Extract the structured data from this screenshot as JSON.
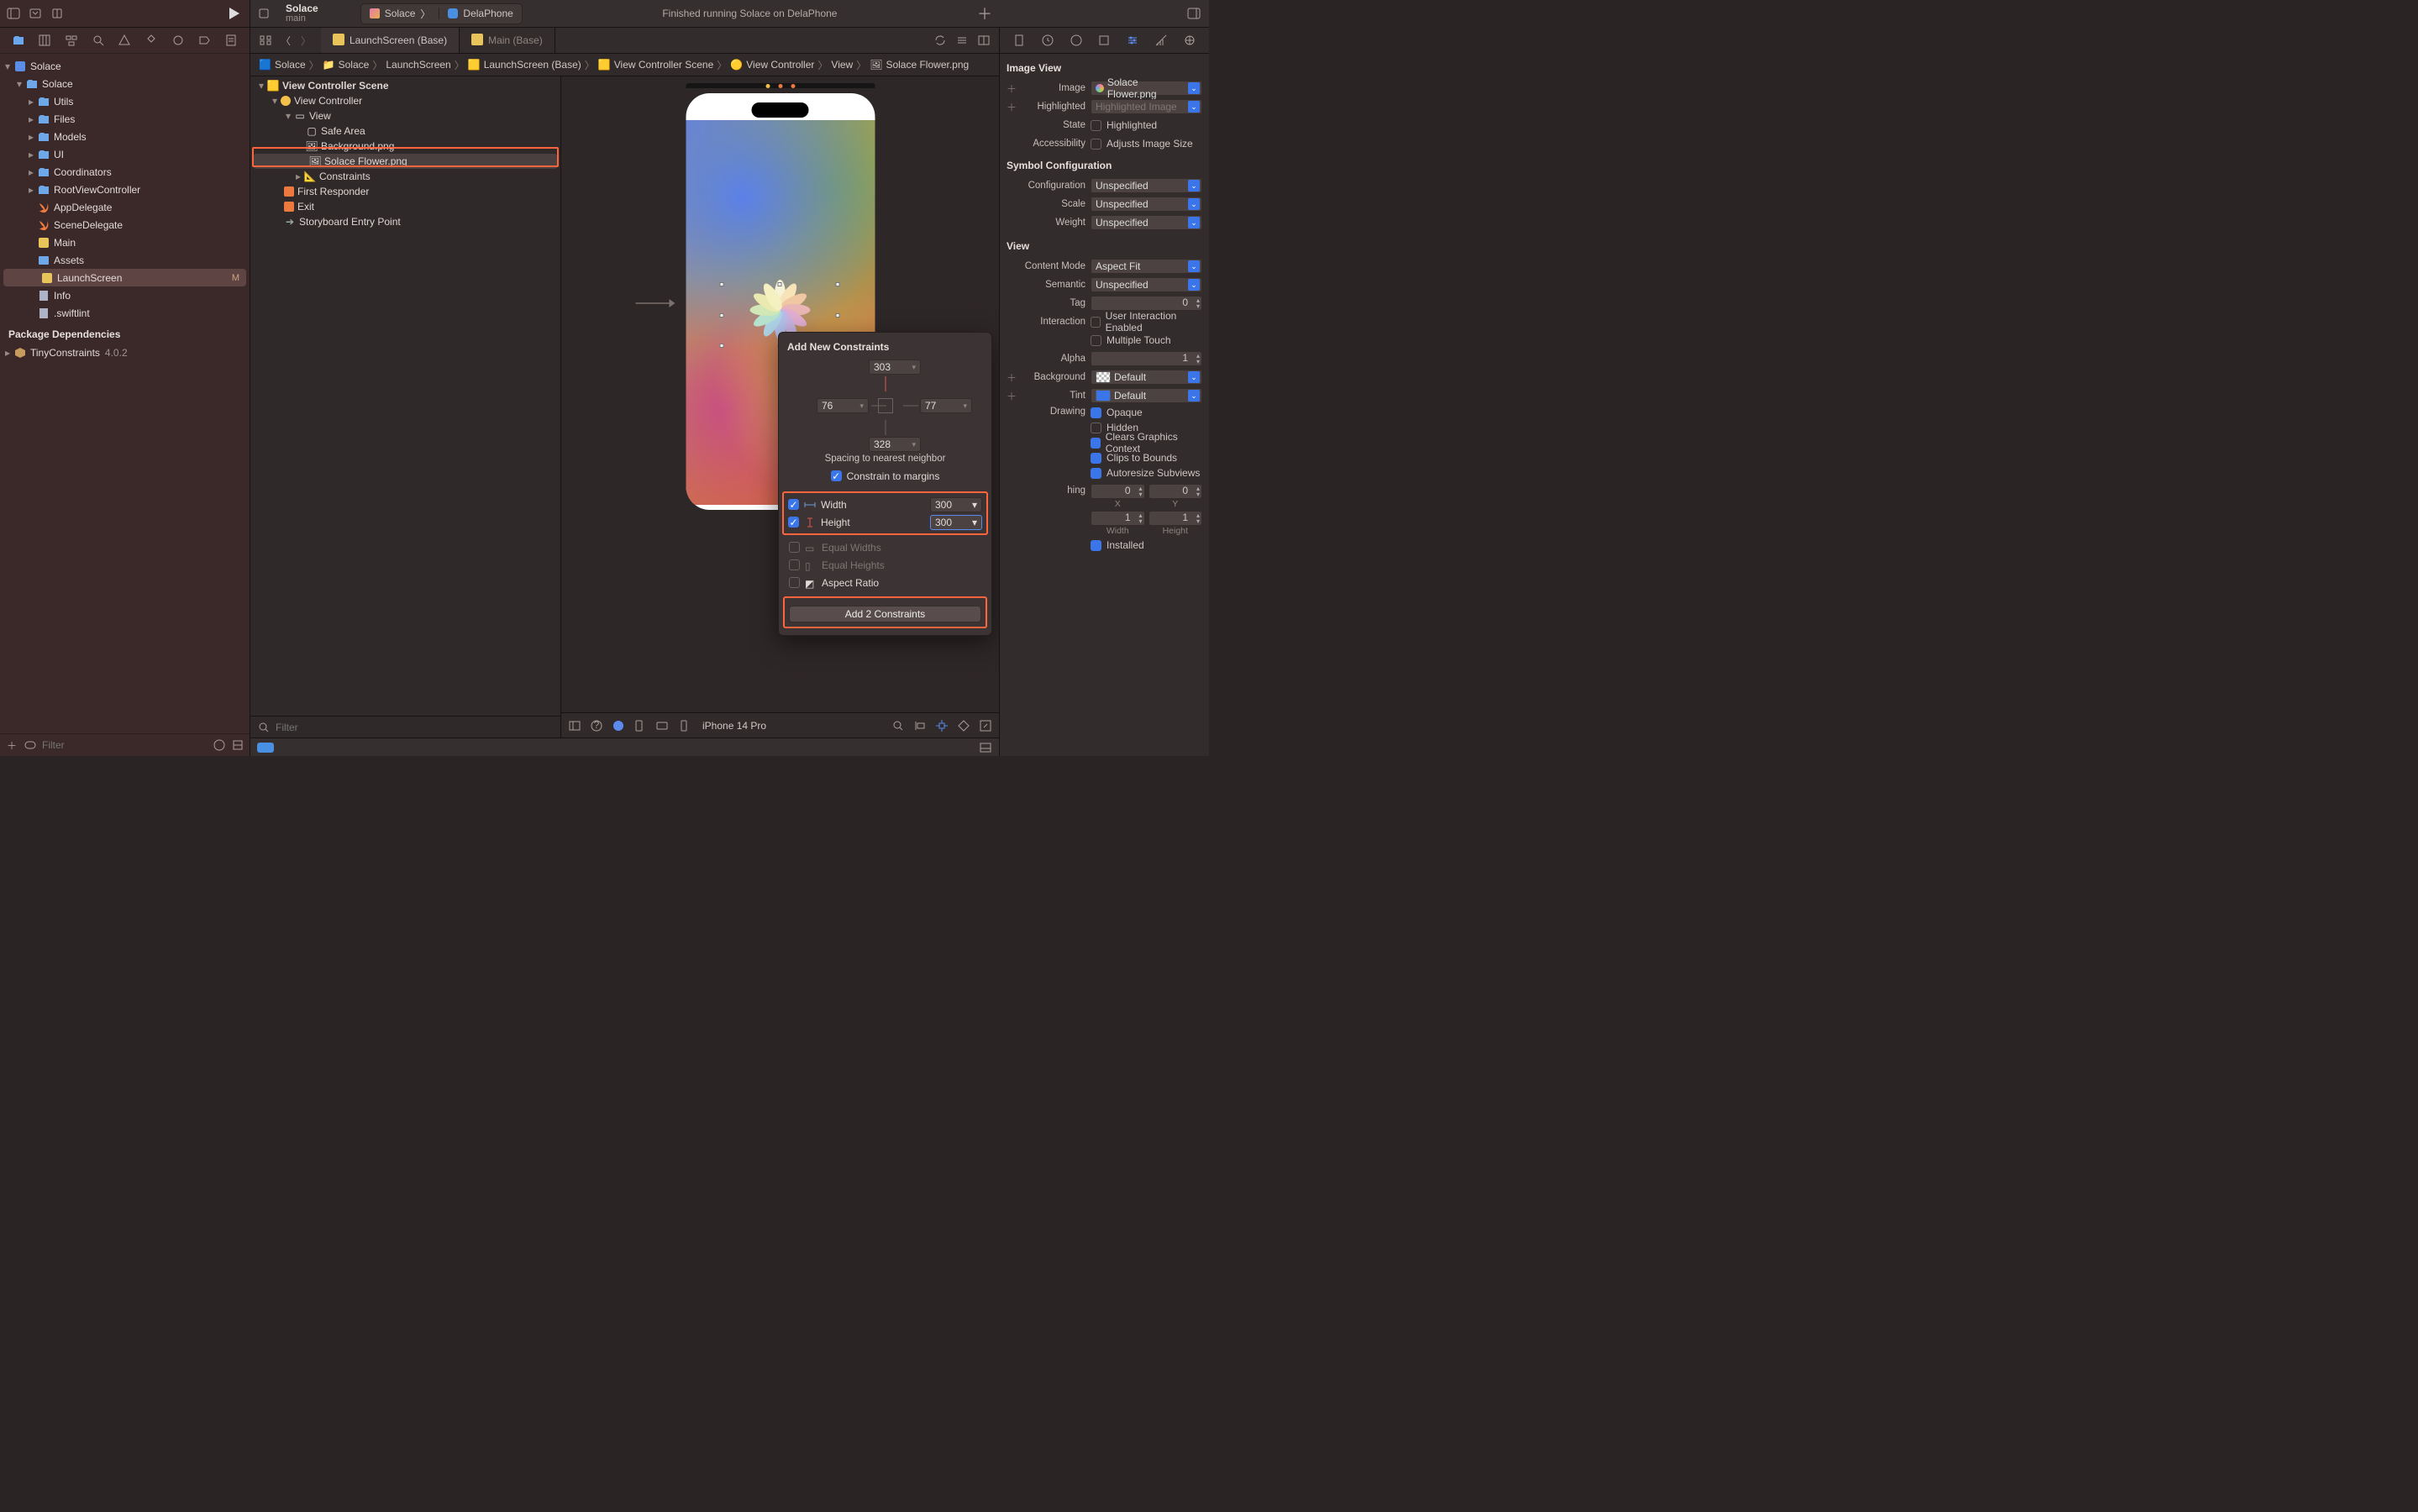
{
  "titlebar": {
    "scheme": {
      "name": "Solace",
      "branch": "main"
    },
    "target": {
      "scheme_app": "Solace",
      "destination": "DelaPhone"
    },
    "status": "Finished running Solace on DelaPhone"
  },
  "nav": {
    "root": "Solace",
    "groups": [
      {
        "name": "Solace",
        "expanded": true,
        "children": [
          {
            "name": "Utils",
            "type": "folder"
          },
          {
            "name": "Files",
            "type": "folder"
          },
          {
            "name": "Models",
            "type": "folder"
          },
          {
            "name": "UI",
            "type": "folder"
          },
          {
            "name": "Coordinators",
            "type": "folder"
          },
          {
            "name": "RootViewController",
            "type": "folder"
          },
          {
            "name": "AppDelegate",
            "type": "swift"
          },
          {
            "name": "SceneDelegate",
            "type": "swift"
          },
          {
            "name": "Main",
            "type": "storyboard"
          },
          {
            "name": "Assets",
            "type": "assets"
          },
          {
            "name": "LaunchScreen",
            "type": "storyboard",
            "selected": true,
            "badge": "M"
          },
          {
            "name": "Info",
            "type": "plist"
          },
          {
            "name": ".swiftlint",
            "type": "file"
          }
        ]
      }
    ],
    "packages_header": "Package Dependencies",
    "packages": [
      {
        "name": "TinyConstraints",
        "version": "4.0.2"
      }
    ],
    "filter_placeholder": "Filter"
  },
  "editor": {
    "tabs": [
      {
        "label": "LaunchScreen (Base)",
        "active": true,
        "kind": "storyboard"
      },
      {
        "label": "Main (Base)",
        "active": false,
        "kind": "storyboard"
      }
    ],
    "breadcrumb": [
      "Solace",
      "Solace",
      "LaunchScreen",
      "LaunchScreen (Base)",
      "View Controller Scene",
      "View Controller",
      "View",
      "Solace Flower.png"
    ],
    "outline": {
      "scene": "View Controller Scene",
      "vc": "View Controller",
      "view": "View",
      "items": [
        "Safe Area",
        "Background.png",
        "Solace Flower.png",
        "Constraints"
      ],
      "selected_index": 2,
      "extra": [
        "First Responder",
        "Exit",
        "Storyboard Entry Point"
      ],
      "filter_placeholder": "Filter"
    },
    "canvas": {
      "device": "iPhone 14 Pro"
    }
  },
  "constraints_popover": {
    "title": "Add New Constraints",
    "top": "303",
    "leading": "76",
    "trailing": "77",
    "bottom": "328",
    "spacing_label": "Spacing to nearest neighbor",
    "constrain_margins": {
      "label": "Constrain to margins",
      "checked": true
    },
    "width": {
      "label": "Width",
      "checked": true,
      "value": "300"
    },
    "height": {
      "label": "Height",
      "checked": true,
      "value": "300"
    },
    "equal_widths": {
      "label": "Equal Widths",
      "checked": false
    },
    "equal_heights": {
      "label": "Equal Heights",
      "checked": false
    },
    "aspect_ratio": {
      "label": "Aspect Ratio",
      "checked": false
    },
    "add_button": "Add 2 Constraints"
  },
  "inspector": {
    "section_imageview": "Image View",
    "image": {
      "label": "Image",
      "value": "Solace Flower.png"
    },
    "highlighted_img": {
      "label": "Highlighted",
      "placeholder": "Highlighted Image"
    },
    "state": {
      "label": "State",
      "value": "Highlighted",
      "checked": false
    },
    "accessibility": {
      "label": "Accessibility",
      "value": "Adjusts Image Size",
      "checked": false
    },
    "symbol_header": "Symbol Configuration",
    "configuration": {
      "label": "Configuration",
      "value": "Unspecified"
    },
    "scale": {
      "label": "Scale",
      "value": "Unspecified"
    },
    "weight": {
      "label": "Weight",
      "value": "Unspecified"
    },
    "section_view": "View",
    "content_mode": {
      "label": "Content Mode",
      "value": "Aspect Fit"
    },
    "semantic": {
      "label": "Semantic",
      "value": "Unspecified"
    },
    "tag": {
      "label": "Tag",
      "value": "0"
    },
    "interaction": {
      "label": "Interaction",
      "a": "User Interaction Enabled",
      "b": "Multiple Touch"
    },
    "alpha": {
      "label": "Alpha",
      "value": "1"
    },
    "background": {
      "label": "Background",
      "value": "Default"
    },
    "tint": {
      "label": "Tint",
      "value": "Default"
    },
    "drawing": {
      "label": "Drawing",
      "opts": [
        {
          "label": "Opaque",
          "on": true
        },
        {
          "label": "Hidden",
          "on": false
        },
        {
          "label": "Clears Graphics Context",
          "on": true
        },
        {
          "label": "Clips to Bounds",
          "on": true
        },
        {
          "label": "Autoresize Subviews",
          "on": true
        }
      ]
    },
    "stretching": {
      "xy": {
        "x": "0",
        "y": "0",
        "xl": "X",
        "yl": "Y"
      },
      "wh": {
        "w": "1",
        "h": "1",
        "wl": "Width",
        "hl": "Height"
      }
    },
    "installed": {
      "label": "Installed",
      "on": true
    }
  }
}
